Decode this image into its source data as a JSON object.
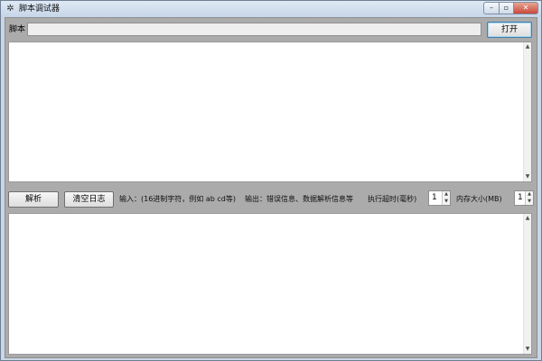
{
  "window": {
    "title": "脚本调试器",
    "icon": "bug-icon",
    "controls": {
      "minimize": "–",
      "maximize": "▫",
      "close": "✕"
    }
  },
  "script_row": {
    "label": "脚本",
    "value": "",
    "open_button": "打开"
  },
  "toolbar": {
    "parse_button": "解析",
    "clear_log_button": "清空日志",
    "input_hint": "输入：(16进制字符，例如 ab cd等)",
    "output_hint": "输出：错误信息、数据解析信息等",
    "timeout_label": "执行超时(毫秒)",
    "timeout_value": "1",
    "memory_label": "内存大小(MB)",
    "memory_value": "1"
  },
  "input_area": {
    "value": ""
  },
  "output_area": {
    "value": ""
  }
}
